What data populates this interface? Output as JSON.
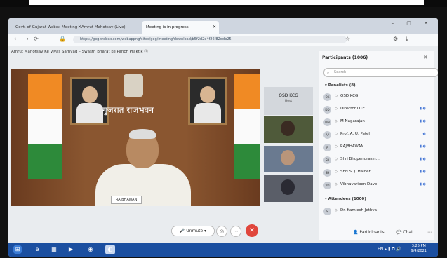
{
  "browser": {
    "tabs": [
      {
        "label": "Govt. of Gujarat Webex Meeting",
        "active": false
      },
      {
        "label": "Amrut Mahotsav (Live)",
        "active": false
      },
      {
        "label": "Meeting is in progress",
        "active": true
      }
    ],
    "url": "https://gog.webex.com/webappng/sites/gog/meeting/download/b5f2d2e4f26f82ddb25"
  },
  "meeting": {
    "title": "Amrut Mahotsav Ke Vivas Samvad – Swasth Bharat ke Panch Praktik ⓘ",
    "hindi_banner": "गुजरात राजभवन",
    "speaker_tag": "RAJBHAWAN",
    "thumbnails": {
      "osd_name": "OSD KCG",
      "osd_sub": "Host"
    }
  },
  "controls": {
    "unmute": "Unmute",
    "participants": "Participants",
    "chat": "Chat"
  },
  "panel": {
    "title": "Participants (1006)",
    "search_placeholder": "Search",
    "panelists_label": "Panelists (8)",
    "attendees_label": "Attendees (1000)",
    "panelists": [
      {
        "initials": "OK",
        "name": "OSD KCG",
        "sub": "Host, me"
      },
      {
        "initials": "DD",
        "name": "Director DTE"
      },
      {
        "initials": "MN",
        "name": "M Nagarajan"
      },
      {
        "initials": "AP",
        "name": "Prof. A. U. Patel"
      },
      {
        "initials": "R",
        "name": "RAJBHAWAN"
      },
      {
        "initials": "SB",
        "name": "Shri Bhupendrasin..."
      },
      {
        "initials": "SH",
        "name": "Shri S. J. Haider"
      },
      {
        "initials": "VD",
        "name": "Vibhavariben Dave"
      }
    ],
    "attendees": [
      {
        "initials": "SJ",
        "name": "Dr. Kamlesh Jethva"
      }
    ]
  },
  "taskbar": {
    "time": "3:25 PM",
    "date": "9/4/2021",
    "lang": "EN"
  },
  "colors": {
    "saffron": "#f08a24",
    "green": "#2d8a3a",
    "endcall": "#e0463c",
    "taskbar": "#1b4fa0"
  }
}
